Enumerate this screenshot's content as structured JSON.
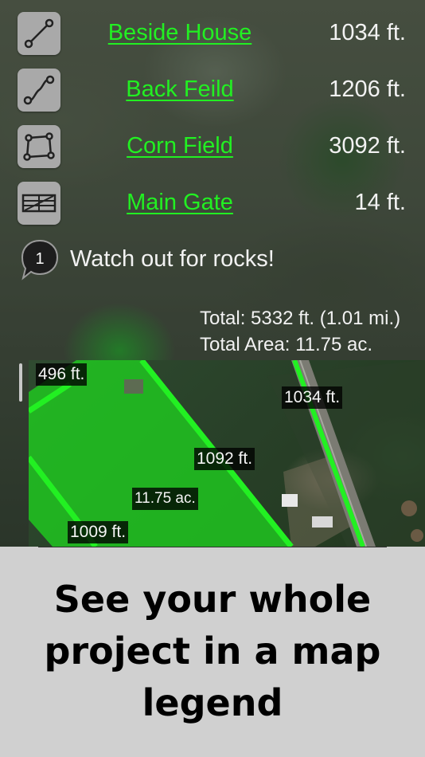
{
  "legend": {
    "items": [
      {
        "name": "Beside House",
        "length": "1034 ft.",
        "icon": "line-tool-icon"
      },
      {
        "name": "Back Feild",
        "length": "1206 ft.",
        "icon": "curve-tool-icon"
      },
      {
        "name": "Corn Field",
        "length": "3092 ft.",
        "icon": "area-tool-icon"
      },
      {
        "name": "Main Gate",
        "length": "14 ft.",
        "icon": "gate-tool-icon"
      }
    ],
    "note": {
      "badge": "1",
      "text": "Watch out for rocks!"
    },
    "total_length": "Total: 5332 ft. (1.01 mi.)",
    "total_area": "Total Area: 11.75 ac."
  },
  "map_labels": {
    "edge_1": "496 ft.",
    "edge_2": "1034 ft.",
    "edge_3": "1092 ft.",
    "area": "11.75 ac.",
    "edge_4": "1009 ft."
  },
  "caption": {
    "line1": "See your whole",
    "line2": "project in a map",
    "line3": "legend"
  },
  "colors": {
    "accent_green": "#22f022",
    "tool_button": "#a9a9a9",
    "caption_bg": "#d0d0d0"
  }
}
